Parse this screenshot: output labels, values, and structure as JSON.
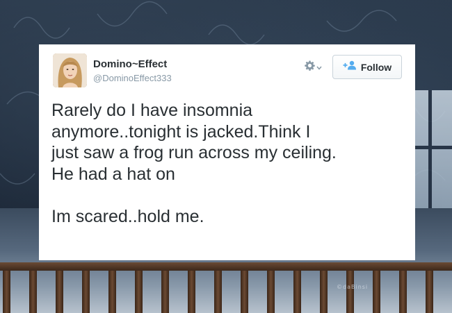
{
  "tweet": {
    "display_name": "Domino~Effect",
    "handle": "@DominoEffect333",
    "follow_label": "Follow",
    "text_lines": [
      "Rarely do I have insomnia",
      "anymore..tonight is jacked.Think I",
      "just saw a frog run across my ceiling.",
      "He had a hat on"
    ],
    "text_closing": "Im scared..hold me."
  },
  "watermark": "©daBinsi",
  "icons": {
    "gear": "gear-icon",
    "chevron": "chevron-down-icon",
    "follow": "follow-person-plus-icon"
  },
  "colors": {
    "follow_icon": "#55acee",
    "text": "#292f33",
    "muted": "#8899a6"
  }
}
